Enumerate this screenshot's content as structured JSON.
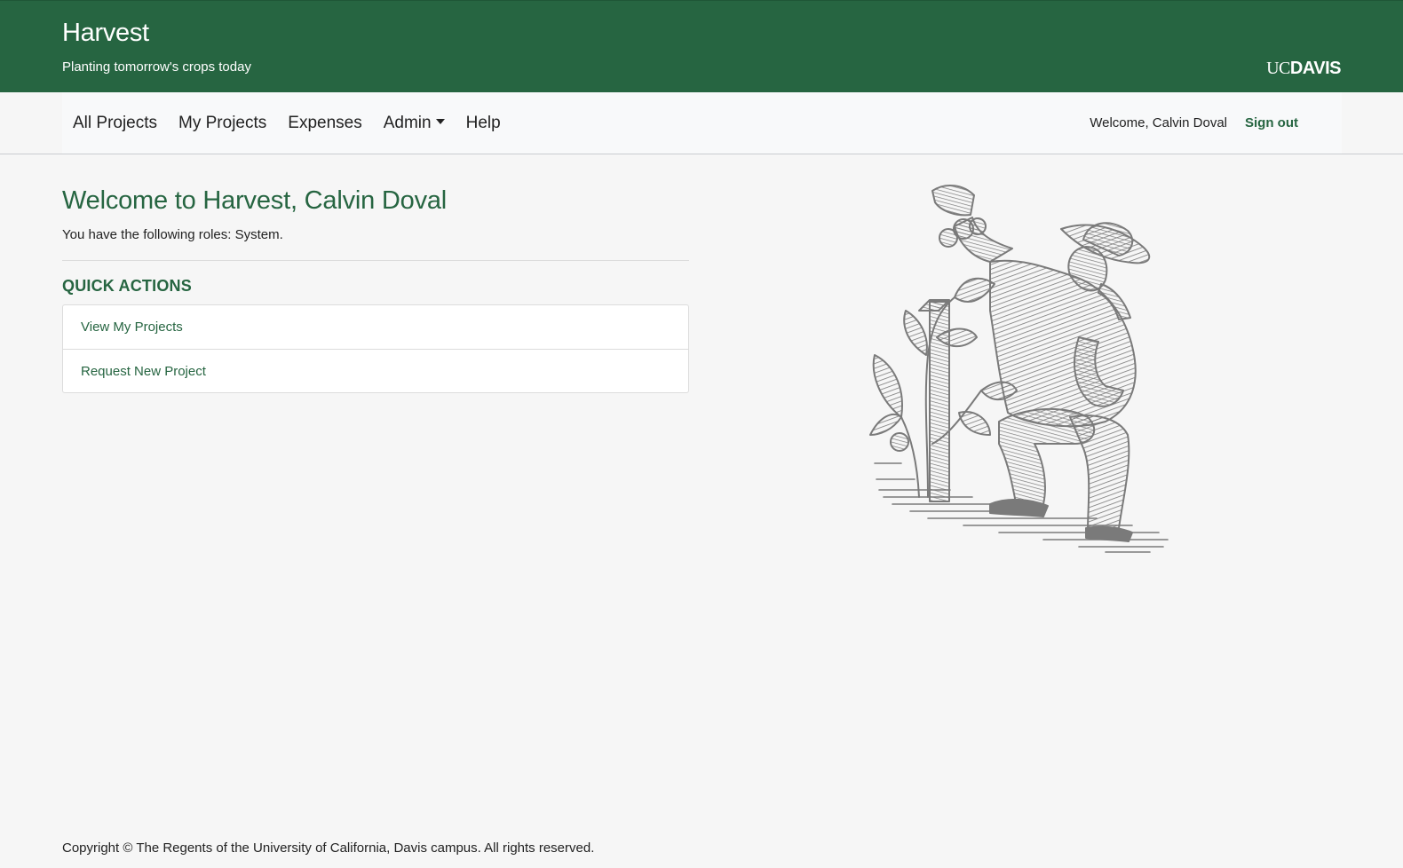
{
  "app": {
    "title": "Harvest",
    "tagline": "Planting tomorrow's crops today",
    "logo_uc": "UC",
    "logo_davis": "DAVIS"
  },
  "nav": {
    "items": [
      {
        "label": "All Projects"
      },
      {
        "label": "My Projects"
      },
      {
        "label": "Expenses"
      },
      {
        "label": "Admin",
        "has_dropdown": true
      },
      {
        "label": "Help"
      }
    ],
    "welcome": "Welcome, Calvin Doval",
    "signout": "Sign out"
  },
  "main": {
    "title": "Welcome to Harvest, Calvin Doval",
    "roles": "You have the following roles: System.",
    "quick_actions_heading": "QUICK ACTIONS",
    "quick_actions": [
      {
        "label": "View My Projects"
      },
      {
        "label": "Request New Project"
      }
    ]
  },
  "footer": {
    "copyright": "Copyright © The Regents of the University of California, Davis campus. All rights reserved."
  },
  "colors": {
    "brand_green": "#266541",
    "page_bg": "#f6f6f6",
    "illustration_gray": "#7a7a7a"
  },
  "illustration": {
    "subject": "farmer-kneeling-harvesting-tomatoes-illustration"
  }
}
